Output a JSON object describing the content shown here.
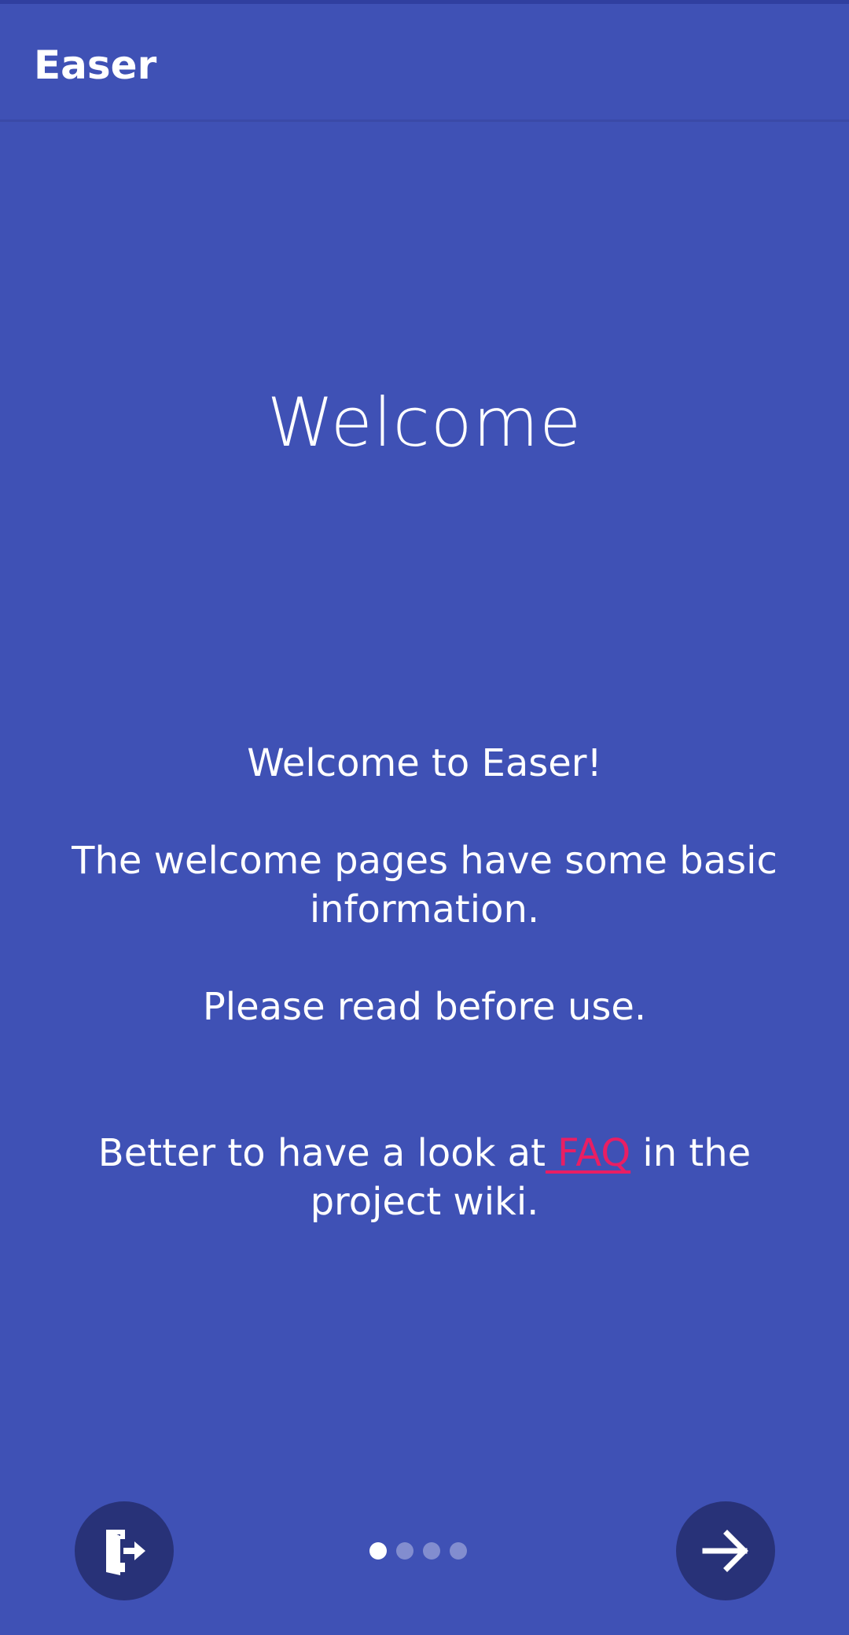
{
  "app_bar": {
    "title": "Easer"
  },
  "slide": {
    "title": "Welcome",
    "line_1": "Welcome to Easer!",
    "line_2": "The welcome pages have some basic information.",
    "line_3": "Please read before use.",
    "line_4_before": "Better to have a look at",
    "line_4_link": " FAQ",
    "line_4_after": " in the project wiki."
  },
  "pager": {
    "page_count": 4,
    "current_page": 1
  },
  "buttons": {
    "skip_icon": "exit-door-icon",
    "next_icon": "arrow-right-icon"
  },
  "colors": {
    "background": "#3f51b5",
    "button": "#283278",
    "link": "#e91e63"
  }
}
